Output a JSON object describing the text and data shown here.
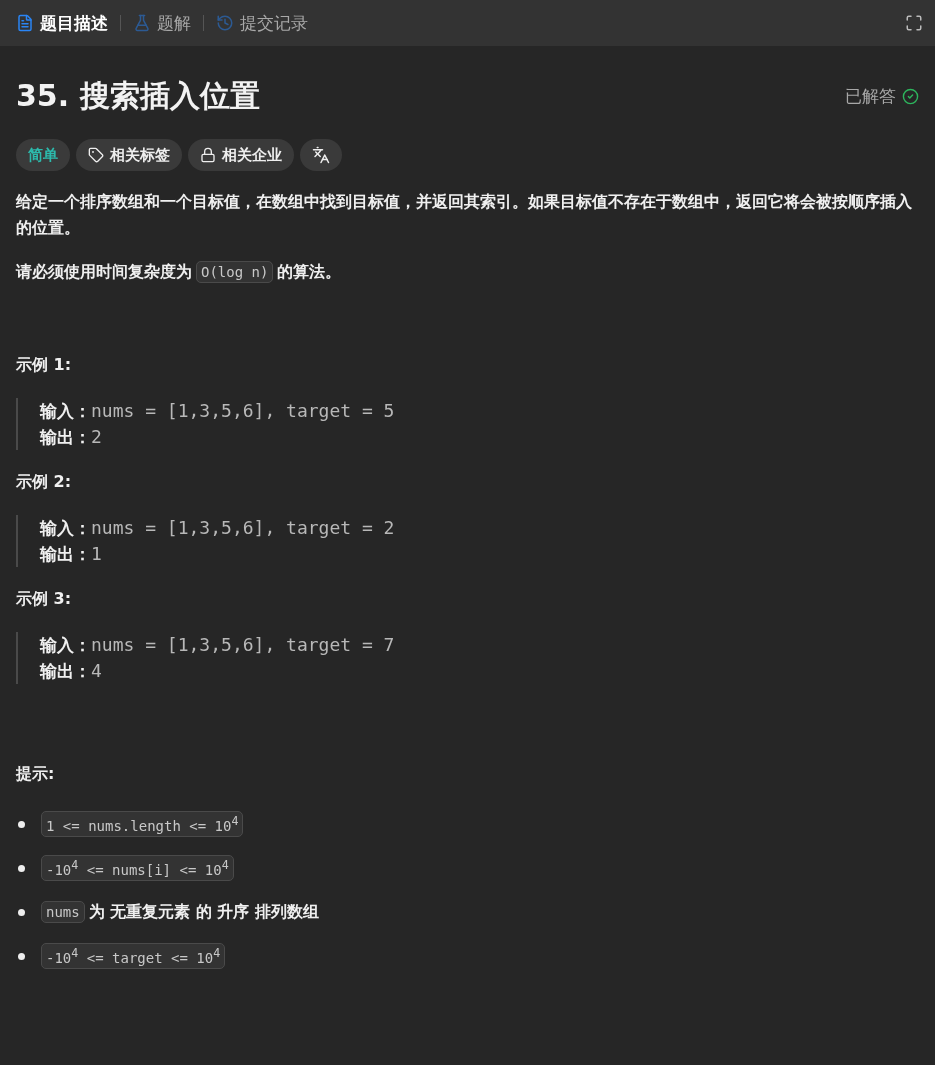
{
  "tabs": [
    {
      "label": "题目描述",
      "kind": "description",
      "selected": true
    },
    {
      "label": "题解",
      "kind": "solution",
      "selected": false
    },
    {
      "label": "提交记录",
      "kind": "history",
      "selected": false
    }
  ],
  "title": "35. 搜索插入位置",
  "status": {
    "label": "已解答",
    "solved": true
  },
  "tags": [
    {
      "kind": "difficulty",
      "label": "简单"
    },
    {
      "kind": "topics",
      "label": "相关标签"
    },
    {
      "kind": "companies",
      "label": "相关企业"
    },
    {
      "kind": "translate"
    }
  ],
  "description": [
    [
      {
        "kind": "text",
        "text": "给定一个排序数组和一个目标值，在数组中找到目标值，并返回其索引。如果目标值不存在于数组中，返回它将会被按顺序插入的位置。"
      }
    ],
    [
      {
        "kind": "text",
        "text": "请必须使用时间复杂度为"
      },
      {
        "kind": "code",
        "text": "O(log n)"
      },
      {
        "kind": "text",
        "text": "的算法。"
      }
    ]
  ],
  "examples": [
    {
      "title": "示例 1:",
      "input_label": "输入：",
      "input": "nums = [1,3,5,6], target = 5",
      "output_label": "输出：",
      "output": "2"
    },
    {
      "title": "示例 2:",
      "input_label": "输入：",
      "input": "nums = [1,3,5,6], target = 2",
      "output_label": "输出：",
      "output": "1"
    },
    {
      "title": "示例 3:",
      "input_label": "输入：",
      "input": "nums = [1,3,5,6], target = 7",
      "output_label": "输出：",
      "output": "4"
    }
  ],
  "hints_title": "提示:",
  "hints": [
    [
      {
        "kind": "code",
        "text": "1 <= nums.length <= 10$^{4}$"
      }
    ],
    [
      {
        "kind": "code",
        "text": "-10$^{4}$ <= nums[i] <= 10$^{4}$"
      }
    ],
    [
      {
        "kind": "code",
        "text": "nums"
      },
      {
        "kind": "text",
        "text": "为 无重复元素 的 升序 排列数组"
      }
    ],
    [
      {
        "kind": "code",
        "text": "-10$^{4}$ <= target <= 10$^{4}$"
      }
    ]
  ]
}
